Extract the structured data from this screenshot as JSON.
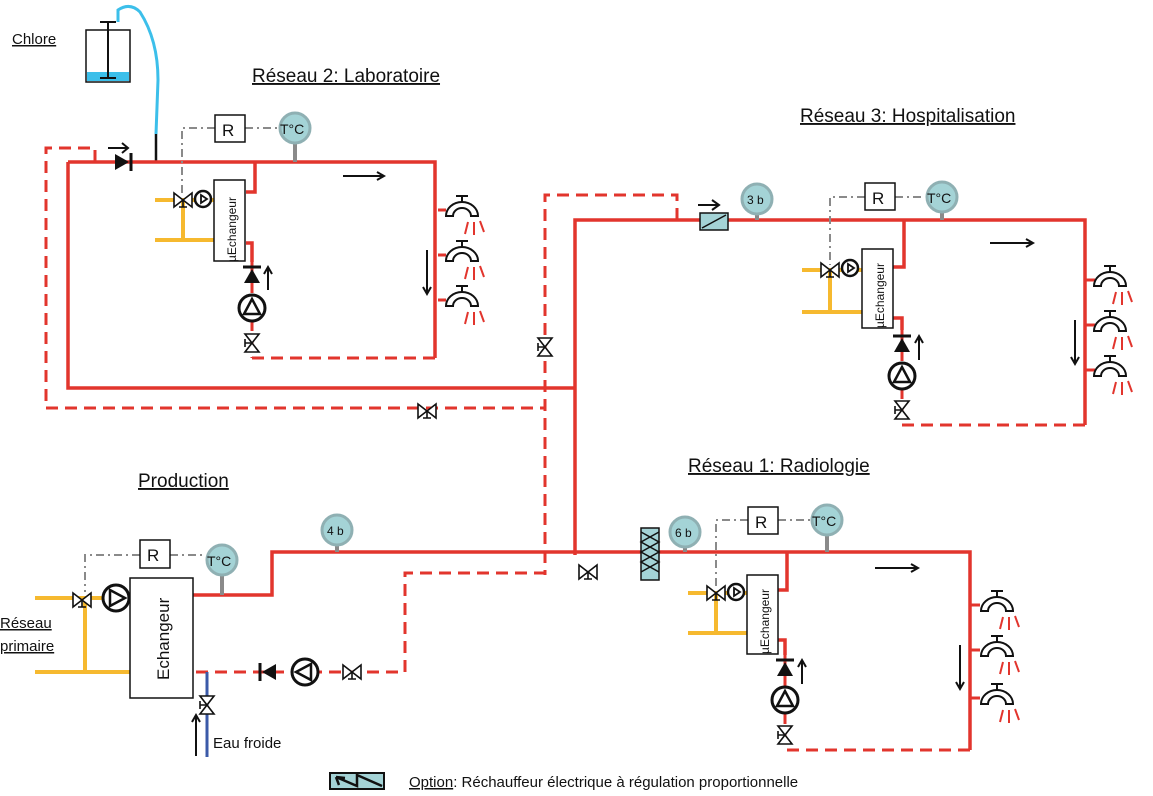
{
  "labels": {
    "chlore": "Chlore",
    "reseau2": "Réseau 2: Laboratoire",
    "reseau3": "Réseau 3: Hospitalisation",
    "reseau1": "Réseau 1: Radiologie",
    "production": "Production",
    "reseau_primaire_1": "Réseau",
    "reseau_primaire_2": "primaire",
    "eau_froide": "Eau froide",
    "micro_echangeur": "µEchangeur",
    "echangeur": "Echangeur",
    "regulator": "R",
    "thermometer": "T°C"
  },
  "gauges": {
    "reseau3": "3 b",
    "production": "4 b",
    "reseau1": "6 b"
  },
  "legend": {
    "option": "Option",
    "text": ": Réchauffeur électrique à régulation proportionnelle"
  },
  "colors": {
    "hot_pipe": "#e2352d",
    "primary_pipe": "#f6b92f",
    "cold_water": "#3b5aa8",
    "chlorine": "#3cbfea",
    "gauge": "#a4d3d6",
    "control_line": "#8a8a8a"
  }
}
